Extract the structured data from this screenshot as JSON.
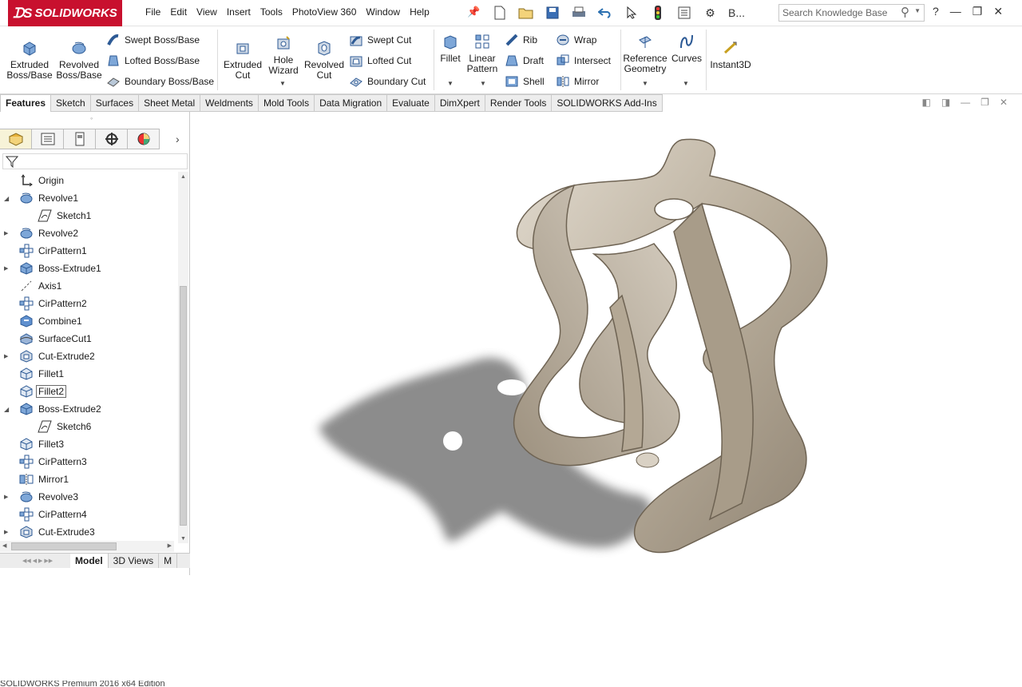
{
  "app": {
    "logo_text": "SOLIDWORKS"
  },
  "menu": [
    "File",
    "Edit",
    "View",
    "Insert",
    "Tools",
    "PhotoView 360",
    "Window",
    "Help"
  ],
  "toolbar": {
    "b_label": "B...",
    "search_placeholder": "Search Knowledge Base",
    "help": "?"
  },
  "ribbon": {
    "extruded_boss": "Extruded Boss/Base",
    "revolved_boss": "Revolved Boss/Base",
    "swept_boss": "Swept Boss/Base",
    "lofted_boss": "Lofted Boss/Base",
    "boundary_boss": "Boundary Boss/Base",
    "extruded_cut": "Extruded Cut",
    "hole_wizard": "Hole Wizard",
    "revolved_cut": "Revolved Cut",
    "swept_cut": "Swept Cut",
    "lofted_cut": "Lofted Cut",
    "boundary_cut": "Boundary Cut",
    "fillet": "Fillet",
    "linear_pattern": "Linear Pattern",
    "rib": "Rib",
    "draft": "Draft",
    "shell": "Shell",
    "wrap": "Wrap",
    "intersect": "Intersect",
    "mirror": "Mirror",
    "reference_geometry": "Reference Geometry",
    "curves": "Curves",
    "instant3d": "Instant3D"
  },
  "tabs": [
    "Features",
    "Sketch",
    "Surfaces",
    "Sheet Metal",
    "Weldments",
    "Mold Tools",
    "Data Migration",
    "Evaluate",
    "DimXpert",
    "Render Tools",
    "SOLIDWORKS Add-Ins"
  ],
  "tree": [
    {
      "label": "Origin",
      "icon": "origin-icon",
      "indent": 0,
      "expander": ""
    },
    {
      "label": "Revolve1",
      "icon": "revolve-icon",
      "indent": 0,
      "expander": "open"
    },
    {
      "label": "Sketch1",
      "icon": "sketch-icon",
      "indent": 1,
      "expander": ""
    },
    {
      "label": "Revolve2",
      "icon": "revolve-icon",
      "indent": 0,
      "expander": "closed"
    },
    {
      "label": "CirPattern1",
      "icon": "pattern-icon",
      "indent": 0,
      "expander": ""
    },
    {
      "label": "Boss-Extrude1",
      "icon": "extrude-icon",
      "indent": 0,
      "expander": "closed"
    },
    {
      "label": "Axis1",
      "icon": "axis-icon",
      "indent": 0,
      "expander": ""
    },
    {
      "label": "CirPattern2",
      "icon": "pattern-icon",
      "indent": 0,
      "expander": ""
    },
    {
      "label": "Combine1",
      "icon": "combine-icon",
      "indent": 0,
      "expander": ""
    },
    {
      "label": "SurfaceCut1",
      "icon": "surfacecut-icon",
      "indent": 0,
      "expander": ""
    },
    {
      "label": "Cut-Extrude2",
      "icon": "cut-icon",
      "indent": 0,
      "expander": "closed"
    },
    {
      "label": "Fillet1",
      "icon": "fillet-icon",
      "indent": 0,
      "expander": ""
    },
    {
      "label": "Fillet2",
      "icon": "fillet-icon",
      "indent": 0,
      "expander": "",
      "selected": true
    },
    {
      "label": "Boss-Extrude2",
      "icon": "extrude-icon",
      "indent": 0,
      "expander": "open"
    },
    {
      "label": "Sketch6",
      "icon": "sketch-icon",
      "indent": 1,
      "expander": ""
    },
    {
      "label": "Fillet3",
      "icon": "fillet-icon",
      "indent": 0,
      "expander": ""
    },
    {
      "label": "CirPattern3",
      "icon": "pattern-icon",
      "indent": 0,
      "expander": ""
    },
    {
      "label": "Mirror1",
      "icon": "mirror-icon",
      "indent": 0,
      "expander": ""
    },
    {
      "label": "Revolve3",
      "icon": "revolve-icon",
      "indent": 0,
      "expander": "closed"
    },
    {
      "label": "CirPattern4",
      "icon": "pattern-icon",
      "indent": 0,
      "expander": ""
    },
    {
      "label": "Cut-Extrude3",
      "icon": "cut-icon",
      "indent": 0,
      "expander": "closed"
    }
  ],
  "bottom_tabs": [
    "Model",
    "3D Views",
    "M"
  ],
  "status": "SOLIDWORKS Premium 2016 x64 Edition",
  "colors": {
    "brand": "#c8102e",
    "accent": "#2a6fb0",
    "model": "#c9bfae"
  }
}
